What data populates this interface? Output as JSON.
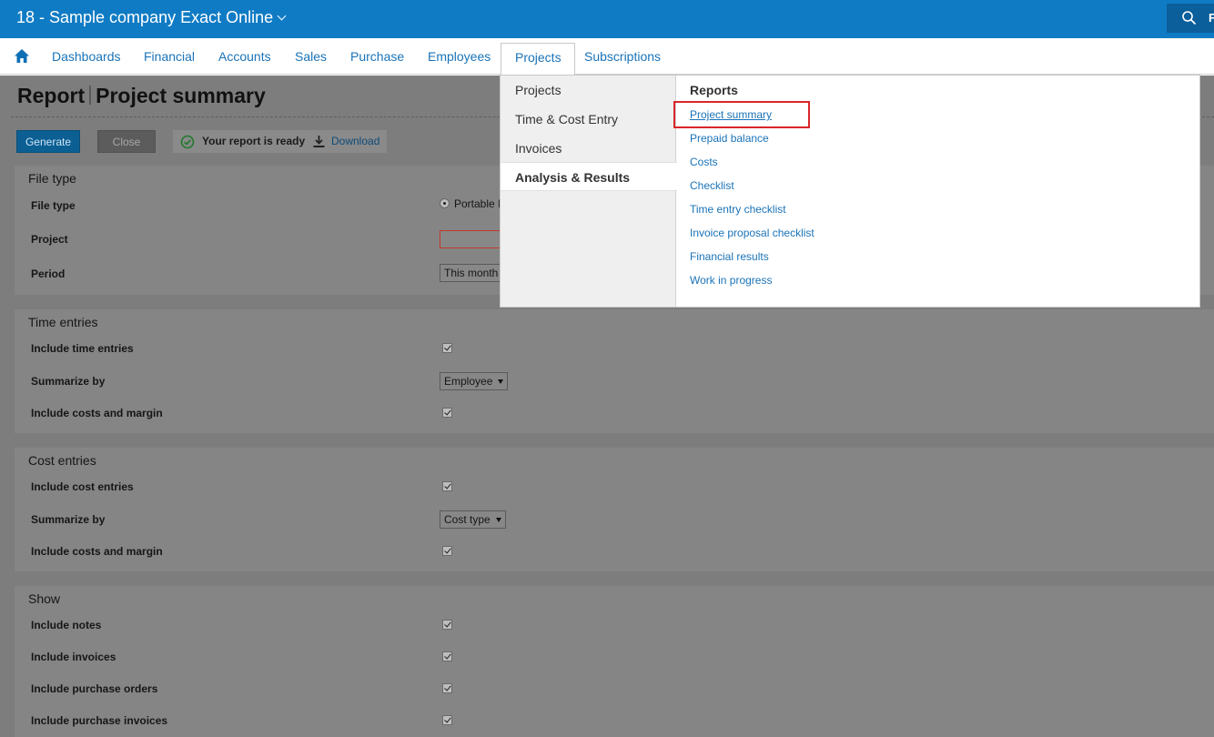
{
  "header": {
    "company": "18 - Sample company Exact Online",
    "search_letter": "F"
  },
  "nav": {
    "items": [
      "Dashboards",
      "Financial",
      "Accounts",
      "Sales",
      "Purchase",
      "Employees",
      "Projects",
      "Subscriptions"
    ],
    "active": "Projects"
  },
  "page": {
    "title_part1": "Report",
    "title_part2": "Project summary"
  },
  "toolbar": {
    "generate_label": "Generate",
    "close_label": "Close",
    "status_text": "Your report is ready",
    "download_label": "Download"
  },
  "sections": {
    "file_type": {
      "head": "File type",
      "file_type_label": "File type",
      "file_type_option": "Portable I",
      "project_label": "Project",
      "period_label": "Period",
      "period_value": "This month"
    },
    "time_entries": {
      "head": "Time entries",
      "include_label": "Include time entries",
      "summarize_label": "Summarize by",
      "summarize_value": "Employee",
      "costs_label": "Include costs and margin"
    },
    "cost_entries": {
      "head": "Cost entries",
      "include_label": "Include cost entries",
      "summarize_label": "Summarize by",
      "summarize_value": "Cost type",
      "costs_label": "Include costs and margin"
    },
    "show": {
      "head": "Show",
      "notes_label": "Include notes",
      "invoices_label": "Include invoices",
      "po_label": "Include purchase orders",
      "pi_label": "Include purchase invoices"
    }
  },
  "menu": {
    "left_items": [
      "Projects",
      "Time & Cost Entry",
      "Invoices",
      "Analysis & Results"
    ],
    "selected": "Analysis & Results",
    "reports_heading": "Reports",
    "report_links": [
      "Project summary",
      "Prepaid balance",
      "Costs",
      "Checklist",
      "Time entry checklist",
      "Invoice proposal checklist",
      "Financial results",
      "Work in progress"
    ]
  },
  "colors": {
    "brand": "#0f7bc4",
    "link": "#1a73b8",
    "highlight": "#d9262b"
  }
}
